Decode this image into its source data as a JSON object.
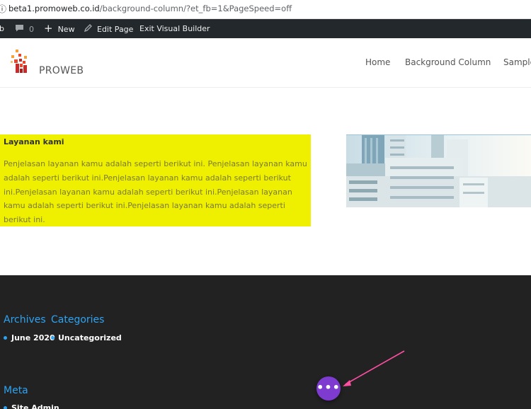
{
  "browser": {
    "url_host": "beta1.promoweb.co.id",
    "url_path": "/background-column/?et_fb=1&PageSpeed=off"
  },
  "admin_bar": {
    "site_fragment": "b",
    "comments_count": "0",
    "new_label": "New",
    "edit_page_label": "Edit Page",
    "exit_builder_label": "Exit Visual Builder"
  },
  "header": {
    "brand": "PROWEB",
    "nav": [
      "Home",
      "Background Column",
      "Sample"
    ]
  },
  "content": {
    "services_title": "Layanan kami",
    "services_body": "Penjelasan layanan kamu adalah seperti berikut ini. Penjelasan layanan kamu adalah seperti berikut ini.Penjelasan layanan kamu adalah seperti berikut ini.Penjelasan layanan kamu adalah seperti berikut ini.Penjelasan layanan kamu adalah seperti berikut ini.Penjelasan layanan kamu adalah seperti berikut ini."
  },
  "footer": {
    "archives_title": "Archives",
    "categories_title": "Categories",
    "archive_item": "June 2020",
    "category_item": "Uncategorized",
    "meta_title": "Meta",
    "meta_item": "Site Admin"
  },
  "builder": {
    "button_glyph": "•••"
  },
  "colors": {
    "accent": "#2ea3f2",
    "highlight": "#eef000",
    "builder_purple": "#7e3bd0",
    "annotation_pink": "#ff4fa3"
  }
}
